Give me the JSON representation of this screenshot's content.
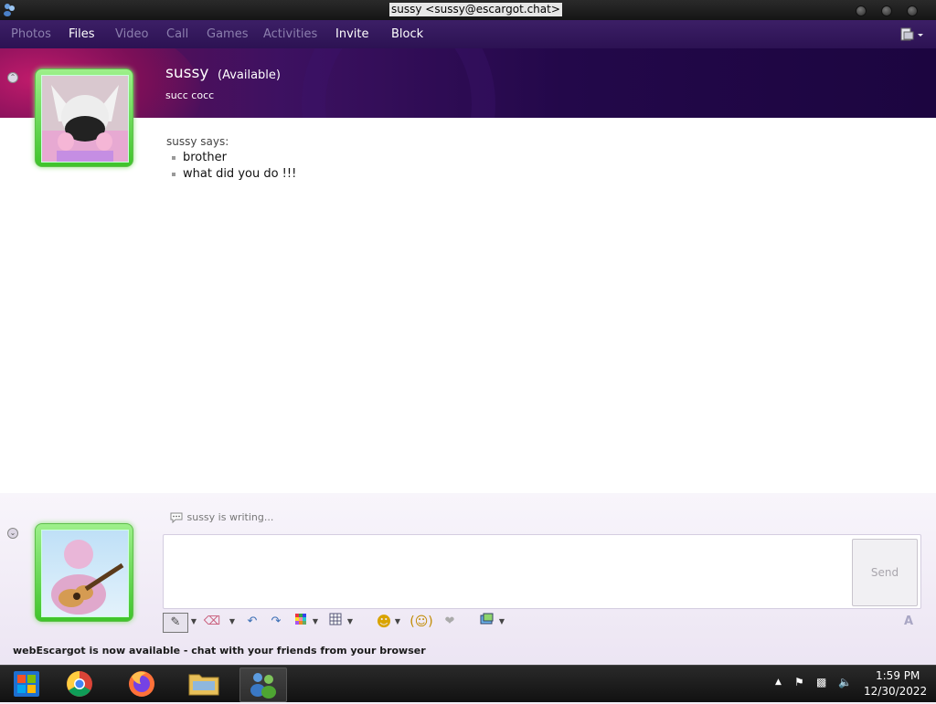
{
  "window": {
    "title": "sussy <sussy@escargot.chat>"
  },
  "menu": {
    "items": [
      {
        "label": "Photos",
        "enabled": false
      },
      {
        "label": "Files",
        "enabled": true
      },
      {
        "label": "Video",
        "enabled": false
      },
      {
        "label": "Call",
        "enabled": false
      },
      {
        "label": "Games",
        "enabled": false
      },
      {
        "label": "Activities",
        "enabled": false
      },
      {
        "label": "Invite",
        "enabled": true
      },
      {
        "label": "Block",
        "enabled": true
      }
    ]
  },
  "contact": {
    "name": "sussy",
    "status": "(Available)",
    "personal_message": "succ cocc"
  },
  "conversation": {
    "sender_label": "sussy says:",
    "messages": [
      "brother",
      "what did you do !!!"
    ]
  },
  "compose": {
    "typing_status": "sussy is writing...",
    "send_label": "Send"
  },
  "notice": "webEscargot is now available - chat with your friends from your browser",
  "taskbar": {
    "time": "1:59 PM",
    "date": "12/30/2022"
  },
  "colors": {
    "menubar": "#2c1253",
    "banner": "#3d1161",
    "avatar_frame": "#3fc42b"
  }
}
